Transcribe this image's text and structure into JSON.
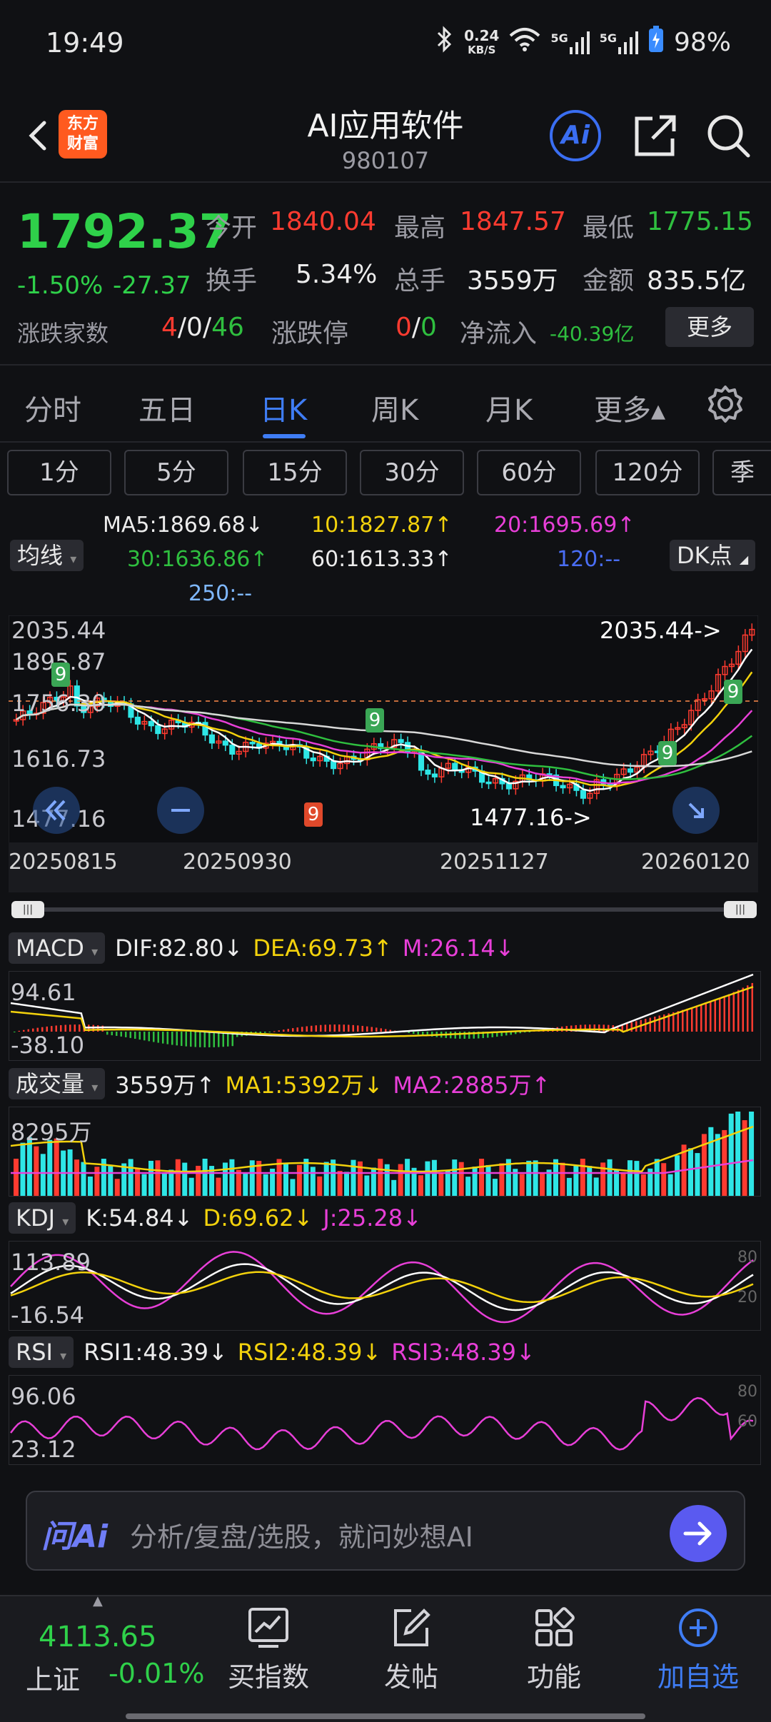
{
  "status_bar": {
    "time": "19:49",
    "net_speed_value": "0.24",
    "net_speed_unit": "KB/S",
    "signal1": "5G",
    "signal2": "5G",
    "battery": "98%"
  },
  "header": {
    "logo_line1": "东方",
    "logo_line2": "财富",
    "title": "AI应用软件",
    "code": "980107",
    "ai_label": "Ai"
  },
  "quote": {
    "price": "1792.37",
    "change_pct": "-1.50%",
    "change_abs": "-27.37",
    "open_label": "今开",
    "open": "1840.04",
    "high_label": "最高",
    "high": "1847.57",
    "low_label": "最低",
    "low": "1775.15",
    "turnover_label": "换手",
    "turnover": "5.34%",
    "volume_label": "总手",
    "volume": "3559万",
    "amount_label": "金额",
    "amount": "835.5亿",
    "breadth_label": "涨跌家数",
    "breadth_up": "4",
    "breadth_flat": "0",
    "breadth_down": "46",
    "limit_label": "涨跌停",
    "limit_up": "0",
    "limit_down": "0",
    "netflow_label": "净流入",
    "netflow": "-40.39亿",
    "more_button": "更多",
    "sep": "/"
  },
  "tabs": [
    "分时",
    "五日",
    "日K",
    "周K",
    "月K",
    "更多▴"
  ],
  "active_tab": "日K",
  "intervals": [
    "1分",
    "5分",
    "15分",
    "30分",
    "60分",
    "120分",
    "季"
  ],
  "ma_legend": {
    "chip": "均线",
    "dk_chip": "DK点",
    "ma5": "MA5:1869.68↓",
    "ma10": "10:1827.87↑",
    "ma20": "20:1695.69↑",
    "ma30": "30:1636.86↑",
    "ma60": "60:1613.33↑",
    "ma120": "120:--",
    "ma250": "250:--"
  },
  "kchart": {
    "y_labels": [
      "2035.44",
      "1895.87",
      "1756.30",
      "1616.73",
      "1477.16"
    ],
    "max_label": "2035.44->",
    "min_label": "1477.16->",
    "dates": [
      "20250815",
      "20250930",
      "20251127",
      "20260120"
    ],
    "td_counts": [
      "9",
      "9",
      "9",
      "9",
      "9"
    ],
    "colors": {
      "up": "#ff3b30",
      "down": "#2ee6e6",
      "ma5": "#ffffff",
      "ma10": "#f3d20c",
      "ma20": "#e83fd8",
      "ma30": "#2fbf3f",
      "ma60": "#d8d8d8"
    }
  },
  "macd": {
    "chip": "MACD",
    "dif": "DIF:82.80↓",
    "dea": "DEA:69.73↑",
    "m": "M:26.14↓",
    "y_top": "94.61",
    "y_bottom": "-38.10"
  },
  "volume": {
    "chip": "成交量",
    "value": "3559万↑",
    "ma1": "MA1:5392万↓",
    "ma2": "MA2:2885万↑",
    "y_top": "8295万"
  },
  "kdj": {
    "chip": "KDJ",
    "k": "K:54.84↓",
    "d": "D:69.62↓",
    "j": "J:25.28↓",
    "y_top": "113.89",
    "y_bottom": "-16.54",
    "level_high": "80",
    "level_low": "20"
  },
  "rsi": {
    "chip": "RSI",
    "rsi1": "RSI1:48.39↓",
    "rsi2": "RSI2:48.39↓",
    "rsi3": "RSI3:48.39↓",
    "y_top": "96.06",
    "y_bottom": "23.12",
    "level_high": "80",
    "level_low": "60"
  },
  "ai_bar": {
    "logo": "问Ai",
    "placeholder": "分析/复盘/选股，就问妙想AI"
  },
  "bottom_bar": {
    "index_value": "4113.65",
    "index_name": "上证",
    "index_change": "-0.01%",
    "items": [
      "买指数",
      "发帖",
      "功能",
      "加自选"
    ]
  }
}
